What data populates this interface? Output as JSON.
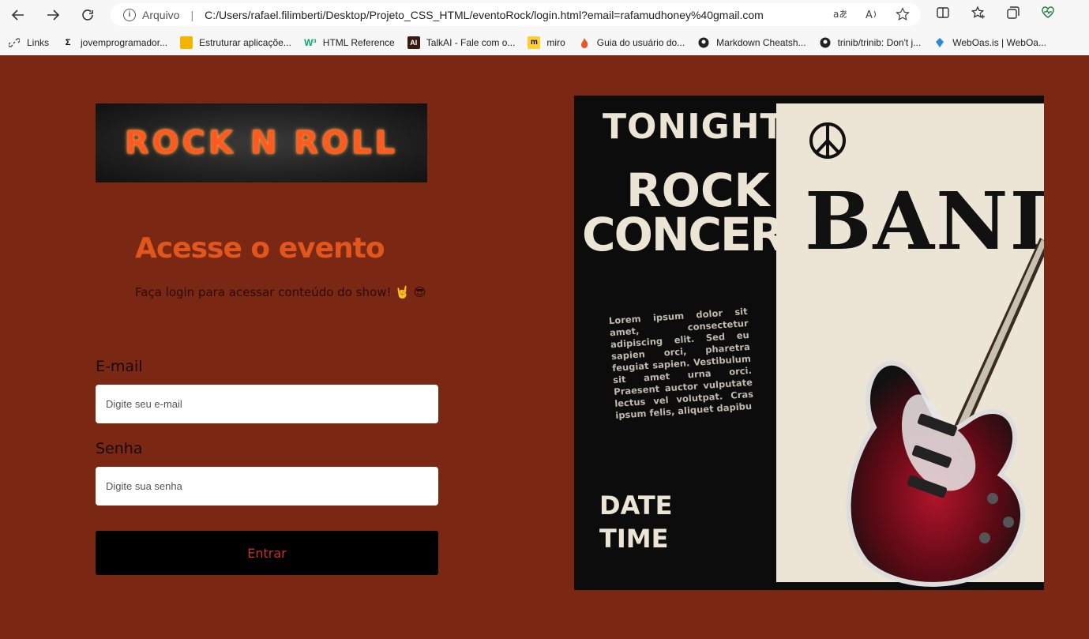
{
  "browser": {
    "address_protocol": "Arquivo",
    "address_url": "C:/Users/rafael.filimberti/Desktop/Projeto_CSS_HTML/eventoRock/login.html?email=rafamudhoney%40gmail.com"
  },
  "bookmarks": [
    {
      "label": "Links",
      "icon": "link-icon"
    },
    {
      "label": "jovemprogramador...",
      "icon": "jp-icon"
    },
    {
      "label": "Estruturar aplicaçõe...",
      "icon": "folder-icon"
    },
    {
      "label": "HTML Reference",
      "icon": "w3-icon"
    },
    {
      "label": "TalkAI - Fale com o...",
      "icon": "ai-icon"
    },
    {
      "label": "miro",
      "icon": "miro-icon"
    },
    {
      "label": "Guia do usuário do...",
      "icon": "flame-icon"
    },
    {
      "label": "Markdown Cheatsh...",
      "icon": "github-icon"
    },
    {
      "label": "trinib/trinib: Don't j...",
      "icon": "github-icon"
    },
    {
      "label": "WebOas.is | WebOa...",
      "icon": "weboasis-icon"
    }
  ],
  "login": {
    "logo_text": "ROCK N ROLL",
    "title": "Acesse o evento",
    "subtitle": "Faça login para acessar conteúdo do show! 🤘 😎",
    "email_label": "E-mail",
    "email_placeholder": "Digite seu e-mail",
    "password_label": "Senha",
    "password_placeholder": "Digite sua senha",
    "submit_label": "Entrar"
  },
  "poster": {
    "tonight": "TONIGHT",
    "rock": "ROCK",
    "concert": "CONCERT",
    "band": "BAND",
    "lorem": "Lorem ipsum dolor sit amet, consectetur adipiscing elit. Sed eu sapien orci, pharetra feugiat sapien. Vestibulum sit amet urna orci. Praesent auctor vulputate lectus vel volutpat. Cras ipsum felis, aliquet dapibu",
    "date": "DATE",
    "time": "TIME"
  },
  "colors": {
    "page_bg": "#7a2814",
    "title": "#e0561c",
    "button_bg": "#000000",
    "button_text": "#c4302b"
  }
}
